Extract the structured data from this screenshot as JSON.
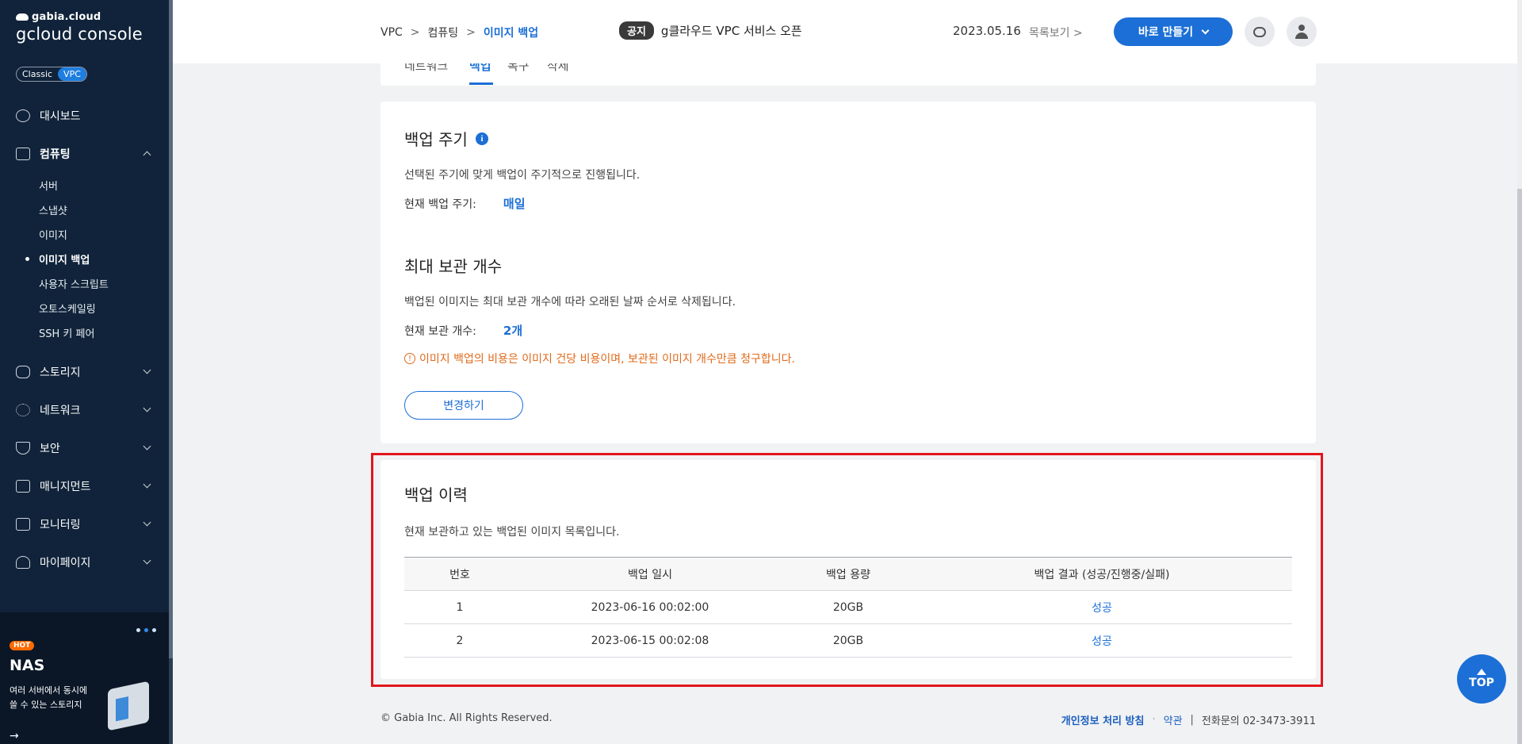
{
  "sidebar": {
    "brand_top": "gabia.cloud",
    "brand_bottom": "gcloud console",
    "mode": {
      "classic": "Classic",
      "vpc": "VPC"
    },
    "items": [
      {
        "label": "대시보드"
      },
      {
        "label": "컴퓨팅"
      },
      {
        "label": "스토리지"
      },
      {
        "label": "네트워크"
      },
      {
        "label": "보안"
      },
      {
        "label": "매니지먼트"
      },
      {
        "label": "모니터링"
      },
      {
        "label": "마이페이지"
      }
    ],
    "computing_sub": [
      "서버",
      "스냅샷",
      "이미지",
      "이미지 백업",
      "사용자 스크립트",
      "오토스케일링",
      "SSH 키 페어"
    ],
    "promo": {
      "hot": "HOT",
      "title": "NAS",
      "desc_1": "여러 서버에서 동시에",
      "desc_2": "쓸 수 있는 스토리지",
      "arrow": "→"
    }
  },
  "header": {
    "breadcrumb": [
      "VPC",
      "컴퓨팅",
      "이미지 백업"
    ],
    "breadcrumb_sep": ">",
    "notice_badge": "공지",
    "notice_text": "g클라우드 VPC 서비스 오픈",
    "notice_date": "2023.05.16",
    "notice_more": "목록보기 >",
    "create_label": "바로 만들기"
  },
  "tabs": [
    "네트워크",
    "백업",
    "복구",
    "삭제"
  ],
  "schedule": {
    "title": "백업 주기",
    "info": "i",
    "desc": "선택된 주기에 맞게 백업이 주기적으로 진행됩니다.",
    "current_label": "현재 백업 주기:",
    "current_value": "매일"
  },
  "retention": {
    "title": "최대 보관 개수",
    "desc": "백업된 이미지는 최대 보관 개수에 따라 오래된 날짜 순서로 삭제됩니다.",
    "current_label": "현재 보관 개수:",
    "current_value": "2개",
    "warning_icon": "!",
    "warning": "이미지 백업의 비용은 이미지 건당 비용이며, 보관된 이미지 개수만큼 청구합니다.",
    "change_label": "변경하기"
  },
  "history": {
    "title": "백업 이력",
    "desc": "현재 보관하고 있는 백업된 이미지 목록입니다.",
    "columns": [
      "번호",
      "백업 일시",
      "백업 용량",
      "백업 결과 (성공/진행중/실패)"
    ],
    "rows": [
      {
        "no": "1",
        "datetime": "2023-06-16 00:02:00",
        "size": "20GB",
        "result": "성공"
      },
      {
        "no": "2",
        "datetime": "2023-06-15 00:02:08",
        "size": "20GB",
        "result": "성공"
      }
    ]
  },
  "footer": {
    "copyright": "© Gabia Inc. All Rights Reserved.",
    "privacy": "개인정보 처리 방침",
    "dot": "·",
    "terms": "약관",
    "bar": "|",
    "phone": "전화문의  02-3473-3911"
  },
  "top_button": "TOP",
  "colors": {
    "accent": "#1b6fd6",
    "sidebar": "#10233a",
    "warning": "#e06a1b",
    "highlight": "#e1161d"
  }
}
